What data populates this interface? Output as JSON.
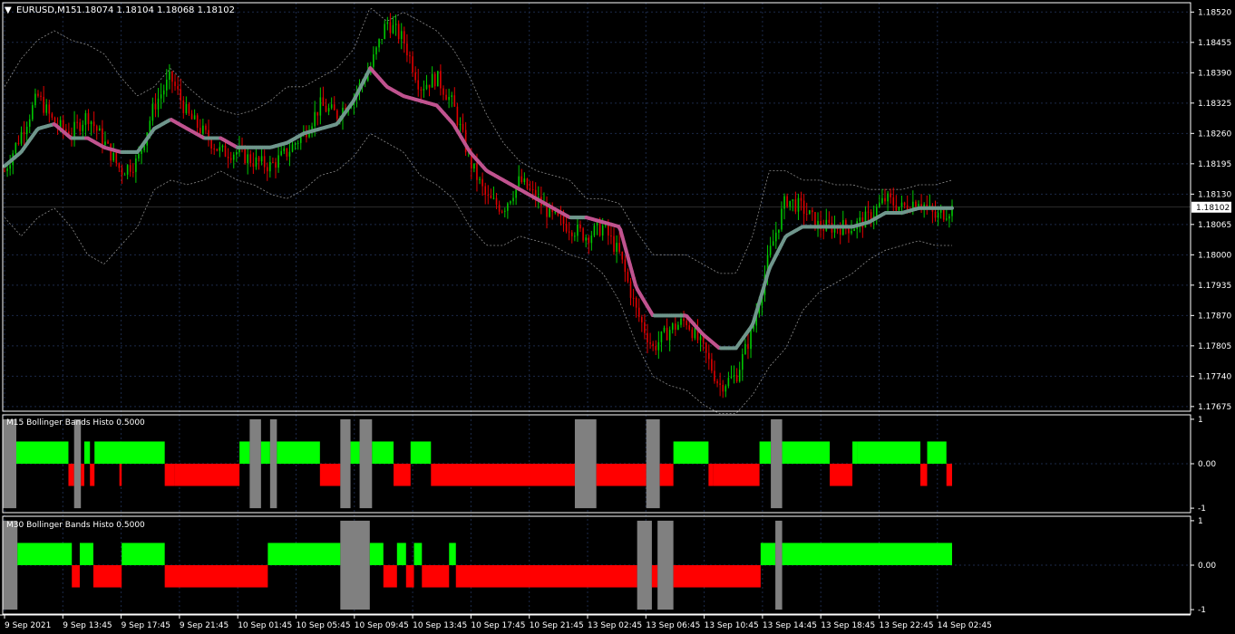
{
  "header": {
    "symbol": "EURUSD,M15",
    "ohlc": "1.18074 1.18104 1.18068 1.18102"
  },
  "colors": {
    "background": "#000000",
    "frame": "#ffffff",
    "grid": "#1c2a4a",
    "bull_candle": "#00c800",
    "bear_candle": "#e00000",
    "midline_up": "#6f968c",
    "midline_down": "#c0538f",
    "bands": "#8c8c8c",
    "histo_up": "#00ff00",
    "histo_down": "#ff0000",
    "histo_neutral": "#808080"
  },
  "chart_data": [
    {
      "type": "candlestick",
      "panel": "main",
      "y_ticks": [
        "1.18520",
        "1.18455",
        "1.18390",
        "1.18325",
        "1.18260",
        "1.18195",
        "1.18130",
        "1.18065",
        "1.18000",
        "1.17935",
        "1.17870",
        "1.17805",
        "1.17740",
        "1.17675"
      ],
      "ylim": [
        1.17665,
        1.1854
      ],
      "current_price": "1.18102",
      "price_path": [
        1.1818,
        1.1826,
        1.1834,
        1.1828,
        1.1826,
        1.183,
        1.1824,
        1.1818,
        1.182,
        1.1832,
        1.1838,
        1.183,
        1.1826,
        1.1822,
        1.1822,
        1.182,
        1.1819,
        1.1822,
        1.1826,
        1.1832,
        1.183,
        1.1834,
        1.184,
        1.185,
        1.1846,
        1.1836,
        1.1838,
        1.1832,
        1.182,
        1.1812,
        1.181,
        1.1816,
        1.1812,
        1.1808,
        1.1806,
        1.1804,
        1.1806,
        1.18,
        1.1788,
        1.178,
        1.1784,
        1.1786,
        1.178,
        1.1772,
        1.1774,
        1.1784,
        1.18,
        1.1812,
        1.181,
        1.1806,
        1.1806,
        1.1806,
        1.1808,
        1.1812,
        1.181,
        1.1812,
        1.1808,
        1.181
      ],
      "midline": [
        1.1819,
        1.1822,
        1.1827,
        1.1828,
        1.1825,
        1.1825,
        1.1823,
        1.1822,
        1.1822,
        1.1827,
        1.1829,
        1.1827,
        1.1825,
        1.1825,
        1.1823,
        1.1823,
        1.1823,
        1.1824,
        1.1826,
        1.1827,
        1.1828,
        1.1833,
        1.184,
        1.1836,
        1.1834,
        1.1833,
        1.1832,
        1.1828,
        1.1822,
        1.1818,
        1.1816,
        1.1814,
        1.1812,
        1.181,
        1.1808,
        1.1808,
        1.1807,
        1.1806,
        1.1793,
        1.1787,
        1.1787,
        1.1787,
        1.1783,
        1.178,
        1.178,
        1.1785,
        1.1797,
        1.1804,
        1.1806,
        1.1806,
        1.1806,
        1.1806,
        1.1807,
        1.1809,
        1.1809,
        1.181,
        1.181,
        1.181
      ],
      "upper_band": [
        1.1836,
        1.1842,
        1.1846,
        1.1848,
        1.1846,
        1.1845,
        1.1843,
        1.1838,
        1.1834,
        1.1836,
        1.184,
        1.1836,
        1.1833,
        1.1831,
        1.183,
        1.1831,
        1.1833,
        1.1836,
        1.1836,
        1.1838,
        1.184,
        1.1844,
        1.1853,
        1.185,
        1.1852,
        1.185,
        1.1848,
        1.1844,
        1.1838,
        1.183,
        1.1824,
        1.182,
        1.1818,
        1.1817,
        1.1816,
        1.1812,
        1.1812,
        1.1811,
        1.1805,
        1.18,
        1.18,
        1.18,
        1.1798,
        1.1796,
        1.1796,
        1.1804,
        1.1818,
        1.1818,
        1.1816,
        1.1816,
        1.1815,
        1.1815,
        1.1814,
        1.1814,
        1.1814,
        1.1815,
        1.1815,
        1.1816
      ],
      "lower_band": [
        1.1808,
        1.1804,
        1.1808,
        1.181,
        1.1806,
        1.18,
        1.1798,
        1.1802,
        1.1806,
        1.1814,
        1.1816,
        1.1815,
        1.1816,
        1.1818,
        1.1816,
        1.1815,
        1.1813,
        1.1812,
        1.1814,
        1.1817,
        1.1818,
        1.1821,
        1.1826,
        1.1824,
        1.1822,
        1.1817,
        1.1815,
        1.1812,
        1.1806,
        1.1802,
        1.1802,
        1.1804,
        1.1803,
        1.1802,
        1.18,
        1.1799,
        1.1796,
        1.179,
        1.1781,
        1.1774,
        1.1772,
        1.1771,
        1.1768,
        1.1766,
        1.1766,
        1.177,
        1.1776,
        1.178,
        1.1788,
        1.1792,
        1.1794,
        1.1796,
        1.1799,
        1.1801,
        1.1802,
        1.1803,
        1.1802,
        1.1802
      ]
    },
    {
      "type": "histogram",
      "panel": "m15",
      "title": "M15 Bollinger Bands Histo 0.5000",
      "y_ticks": [
        "1",
        "0.00",
        "-1"
      ],
      "ylim": [
        -1.1,
        1.1
      ],
      "levels": [
        1,
        -1
      ],
      "segments": [
        {
          "from": 0,
          "to": 1.2,
          "s": "n"
        },
        {
          "from": 1.2,
          "to": 5.8,
          "s": "u"
        },
        {
          "from": 5.8,
          "to": 6.3,
          "s": "d"
        },
        {
          "from": 6.3,
          "to": 6.9,
          "s": "n"
        },
        {
          "from": 6.9,
          "to": 7.2,
          "s": "d"
        },
        {
          "from": 7.2,
          "to": 7.7,
          "s": "u"
        },
        {
          "from": 7.7,
          "to": 8.1,
          "s": "d"
        },
        {
          "from": 8.1,
          "to": 10.5,
          "s": "u"
        },
        {
          "from": 10.5,
          "to": 10.3,
          "s": "d"
        },
        {
          "from": 10.3,
          "to": 14.3,
          "s": "u"
        },
        {
          "from": 14.3,
          "to": 15.2,
          "s": "d"
        },
        {
          "from": 15.2,
          "to": 20.9,
          "s": "d"
        },
        {
          "from": 20.9,
          "to": 21.8,
          "s": "u"
        },
        {
          "from": 21.8,
          "to": 22.8,
          "s": "n"
        },
        {
          "from": 22.8,
          "to": 23.6,
          "s": "u"
        },
        {
          "from": 23.6,
          "to": 24.2,
          "s": "n"
        },
        {
          "from": 24.2,
          "to": 28.0,
          "s": "u"
        },
        {
          "from": 28.0,
          "to": 29.8,
          "s": "d"
        },
        {
          "from": 29.8,
          "to": 30.7,
          "s": "n"
        },
        {
          "from": 30.7,
          "to": 31.5,
          "s": "u"
        },
        {
          "from": 31.5,
          "to": 32.6,
          "s": "n"
        },
        {
          "from": 32.6,
          "to": 34.5,
          "s": "u"
        },
        {
          "from": 34.5,
          "to": 36.0,
          "s": "d"
        },
        {
          "from": 36.0,
          "to": 37.8,
          "s": "u"
        },
        {
          "from": 37.8,
          "to": 50.5,
          "s": "d"
        },
        {
          "from": 50.5,
          "to": 52.4,
          "s": "n"
        },
        {
          "from": 52.4,
          "to": 56.8,
          "s": "d"
        },
        {
          "from": 56.8,
          "to": 58.0,
          "s": "n"
        },
        {
          "from": 58.0,
          "to": 59.2,
          "s": "d"
        },
        {
          "from": 59.2,
          "to": 62.3,
          "s": "u"
        },
        {
          "from": 62.3,
          "to": 62.7,
          "s": "d"
        },
        {
          "from": 62.7,
          "to": 66.8,
          "s": "d"
        },
        {
          "from": 66.8,
          "to": 67.8,
          "s": "u"
        },
        {
          "from": 67.8,
          "to": 68.8,
          "s": "n"
        },
        {
          "from": 68.8,
          "to": 73.0,
          "s": "u"
        },
        {
          "from": 73.0,
          "to": 75.0,
          "s": "d"
        },
        {
          "from": 75.0,
          "to": 75.4,
          "s": "u"
        },
        {
          "from": 75.4,
          "to": 81.0,
          "s": "u"
        },
        {
          "from": 81.0,
          "to": 81.6,
          "s": "d"
        },
        {
          "from": 81.6,
          "to": 83.3,
          "s": "u"
        },
        {
          "from": 83.3,
          "to": 83.8,
          "s": "d"
        }
      ]
    },
    {
      "type": "histogram",
      "panel": "m30",
      "title": "M30 Bollinger Bands Histo 0.5000",
      "y_ticks": [
        "1",
        "0.00",
        "-1"
      ],
      "ylim": [
        -1.1,
        1.1
      ],
      "levels": [
        1,
        -1
      ],
      "segments": [
        {
          "from": 0,
          "to": 1.3,
          "s": "n"
        },
        {
          "from": 1.3,
          "to": 6.1,
          "s": "u"
        },
        {
          "from": 6.1,
          "to": 6.8,
          "s": "d"
        },
        {
          "from": 6.8,
          "to": 8.0,
          "s": "u"
        },
        {
          "from": 8.0,
          "to": 10.5,
          "s": "d"
        },
        {
          "from": 10.5,
          "to": 14.3,
          "s": "u"
        },
        {
          "from": 14.3,
          "to": 23.4,
          "s": "d"
        },
        {
          "from": 23.4,
          "to": 29.8,
          "s": "u"
        },
        {
          "from": 29.8,
          "to": 32.4,
          "s": "n"
        },
        {
          "from": 32.4,
          "to": 33.6,
          "s": "u"
        },
        {
          "from": 33.6,
          "to": 34.8,
          "s": "d"
        },
        {
          "from": 34.8,
          "to": 35.6,
          "s": "u"
        },
        {
          "from": 35.6,
          "to": 36.3,
          "s": "d"
        },
        {
          "from": 36.3,
          "to": 37.0,
          "s": "u"
        },
        {
          "from": 37.0,
          "to": 39.4,
          "s": "d"
        },
        {
          "from": 39.4,
          "to": 40.0,
          "s": "u"
        },
        {
          "from": 40.0,
          "to": 56.0,
          "s": "d"
        },
        {
          "from": 56.0,
          "to": 57.3,
          "s": "n"
        },
        {
          "from": 57.3,
          "to": 57.8,
          "s": "d"
        },
        {
          "from": 57.8,
          "to": 59.2,
          "s": "n"
        },
        {
          "from": 59.2,
          "to": 66.9,
          "s": "d"
        },
        {
          "from": 66.9,
          "to": 68.2,
          "s": "u"
        },
        {
          "from": 68.2,
          "to": 68.8,
          "s": "n"
        },
        {
          "from": 68.8,
          "to": 83.8,
          "s": "u"
        }
      ]
    }
  ],
  "x_axis": {
    "labels": [
      "9 Sep 2021",
      "9 Sep 13:45",
      "9 Sep 17:45",
      "9 Sep 21:45",
      "10 Sep 01:45",
      "10 Sep 05:45",
      "10 Sep 09:45",
      "10 Sep 13:45",
      "10 Sep 17:45",
      "10 Sep 21:45",
      "13 Sep 02:45",
      "13 Sep 06:45",
      "13 Sep 10:45",
      "13 Sep 14:45",
      "13 Sep 18:45",
      "13 Sep 22:45",
      "14 Sep 02:45"
    ]
  }
}
